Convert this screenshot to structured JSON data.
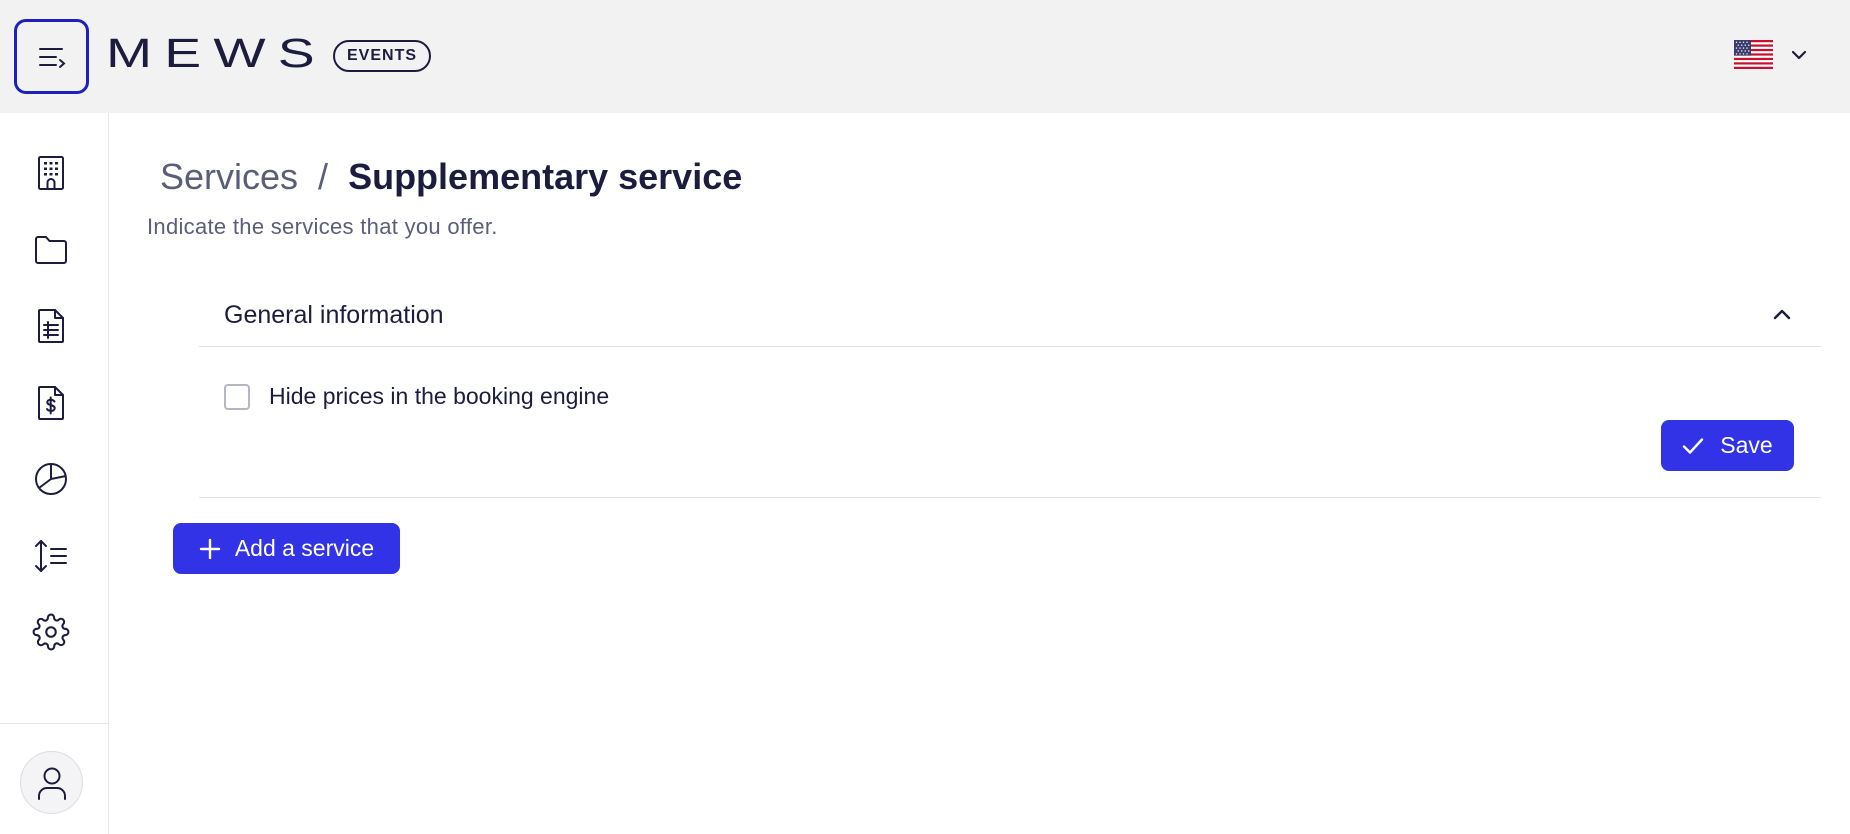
{
  "header": {
    "logo_text": "MEWS",
    "product_badge": "EVENTS",
    "menu_icon": "menu-collapse-icon",
    "language_flag": "us-flag-icon"
  },
  "sidebar": {
    "items": [
      {
        "icon": "building-icon",
        "label": "Properties"
      },
      {
        "icon": "folder-icon",
        "label": "Files"
      },
      {
        "icon": "document-list-icon",
        "label": "Documents"
      },
      {
        "icon": "invoice-icon",
        "label": "Invoices"
      },
      {
        "icon": "pie-chart-icon",
        "label": "Reports"
      },
      {
        "icon": "sort-list-icon",
        "label": "Ordering"
      },
      {
        "icon": "gear-icon",
        "label": "Settings"
      }
    ],
    "user_icon": "user-icon"
  },
  "breadcrumb": {
    "parent": "Services",
    "separator": "/",
    "current": "Supplementary service"
  },
  "subtitle": "Indicate the services that you offer.",
  "section": {
    "title": "General information",
    "checkbox_label": "Hide prices in the booking engine",
    "checkbox_checked": false,
    "save_label": "Save"
  },
  "add_service_label": "Add a service",
  "colors": {
    "primary": "#3232e6",
    "focus_ring": "#1f1fbf",
    "text": "#1c1d3e",
    "muted_text": "#5b5e78",
    "header_bg": "#f2f2f2"
  }
}
